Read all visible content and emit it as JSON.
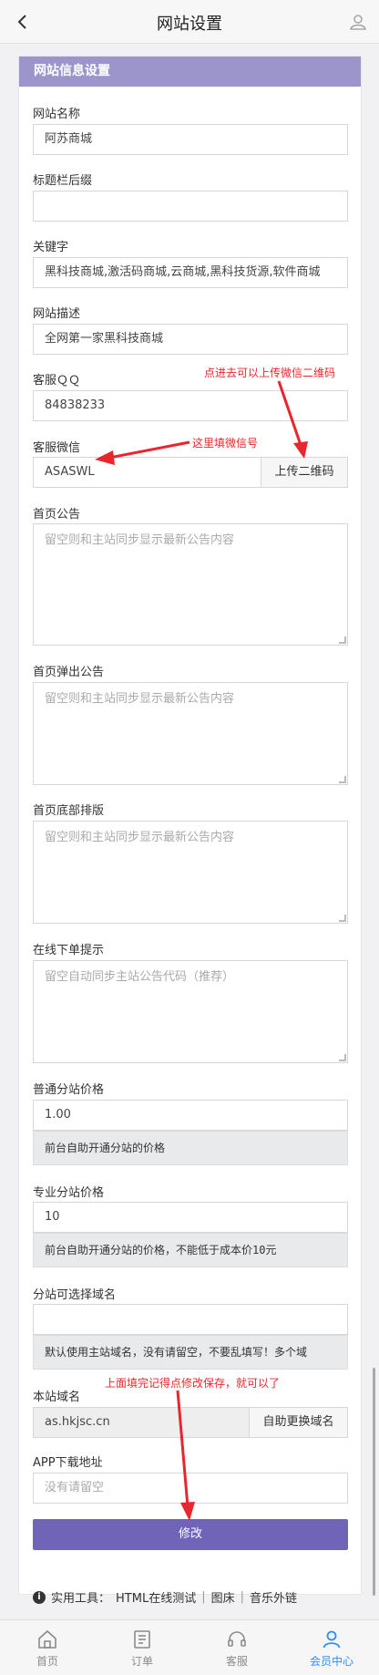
{
  "header": {
    "title": "网站设置"
  },
  "panel": {
    "title": "网站信息设置"
  },
  "fields": {
    "site_name": {
      "label": "网站名称",
      "value": "阿苏商城"
    },
    "title_suffix": {
      "label": "标题栏后缀",
      "value": ""
    },
    "keywords": {
      "label": "关键字",
      "value": "黑科技商城,激活码商城,云商城,黑科技货源,软件商城"
    },
    "description": {
      "label": "网站描述",
      "value": "全网第一家黑科技商城"
    },
    "qq": {
      "label": "客服ＱＱ",
      "value": "84838233"
    },
    "wechat": {
      "label": "客服微信",
      "value": "ASASWL",
      "upload_button": "上传二维码"
    },
    "home_notice": {
      "label": "首页公告",
      "placeholder": "留空则和主站同步显示最新公告内容"
    },
    "popup_notice": {
      "label": "首页弹出公告",
      "placeholder": "留空则和主站同步显示最新公告内容"
    },
    "footer": {
      "label": "首页底部排版",
      "placeholder": "留空则和主站同步显示最新公告内容"
    },
    "order_tip": {
      "label": "在线下单提示",
      "placeholder": "留空自动同步主站公告代码（推荐）"
    },
    "normal_price": {
      "label": "普通分站价格",
      "value": "1.00",
      "hint": "前台自助开通分站的价格"
    },
    "pro_price": {
      "label": "专业分站价格",
      "value": "10",
      "hint": "前台自助开通分站的价格，不能低于成本价10元"
    },
    "domains": {
      "label": "分站可选择域名",
      "value": "",
      "hint": "默认使用主站域名，没有请留空，不要乱填写！多个域"
    },
    "site_domain": {
      "label": "本站域名",
      "value": "as.hkjsc.cn",
      "button": "自助更换域名"
    },
    "app_url": {
      "label": "APP下载地址",
      "placeholder": "没有请留空"
    }
  },
  "submit_label": "修改",
  "tools": {
    "prefix": "实用工具：",
    "items": [
      "HTML在线测试",
      "图床",
      "音乐外链"
    ],
    "separator": "|"
  },
  "annotations": {
    "upload_tip": "点进去可以上传微信二维码",
    "wechat_tip": "这里填微信号",
    "save_tip": "上面填完记得点修改保存，就可以了"
  },
  "tabs": [
    {
      "label": "首页",
      "icon": "home-icon"
    },
    {
      "label": "订单",
      "icon": "order-icon"
    },
    {
      "label": "客服",
      "icon": "headset-icon"
    },
    {
      "label": "会员中心",
      "icon": "user-icon",
      "active": true
    }
  ],
  "colors": {
    "panel_header": "#9b95cc",
    "submit": "#6f64b8",
    "annotation": "#e8262d",
    "active_tab": "#2f8ff0"
  }
}
